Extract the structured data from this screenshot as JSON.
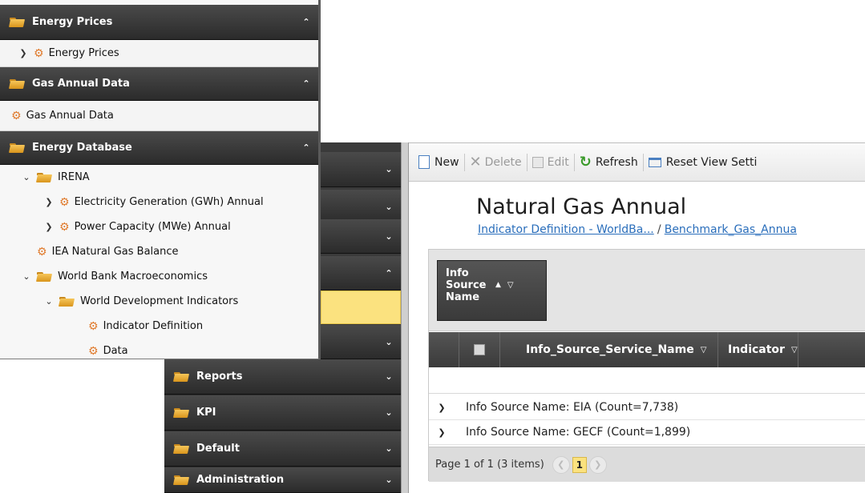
{
  "left_panel": {
    "section1": {
      "title": "Energy Prices",
      "items": [
        {
          "label": "Energy Prices"
        }
      ]
    },
    "section2": {
      "title": "Gas Annual Data",
      "items": [
        {
          "label": "Gas Annual Data"
        }
      ]
    },
    "section3": {
      "title": "Energy Database",
      "tree": {
        "irena": "IRENA",
        "electricity": "Electricity Generation (GWh) Annual",
        "power_capacity": "Power Capacity (MWe) Annual",
        "iea_gas": "IEA Natural Gas Balance",
        "world_bank": "World Bank Macroeconomics",
        "wdi": "World Development Indicators",
        "indicator_def": "Indicator Definition",
        "data": "Data"
      }
    }
  },
  "back_nav": {
    "sections": [
      "Reports",
      "KPI",
      "Default",
      "Administration"
    ]
  },
  "toolbar": {
    "new": "New",
    "delete": "Delete",
    "edit": "Edit",
    "refresh": "Refresh",
    "reset": "Reset View Setti"
  },
  "page": {
    "title": "Natural Gas Annual",
    "breadcrumb1": "Indicator Definition - WorldBa...",
    "breadcrumb_sep": "/",
    "breadcrumb2": "Benchmark_Gas_Annua"
  },
  "grid": {
    "group_chip": "Info Source Name",
    "columns": [
      "Info_Source_Service_Name",
      "Indicator"
    ],
    "groups": [
      "Info Source Name: EIA (Count=7,738)",
      "Info Source Name: GECF (Count=1,899)"
    ],
    "pager_text": "Page 1 of 1 (3 items)",
    "current_page": "1"
  },
  "colors": {
    "nav_dark": "#3a3a3a",
    "selected": "#fbe27f",
    "accent_link": "#2a6ebb",
    "gear": "#e07a2c"
  }
}
